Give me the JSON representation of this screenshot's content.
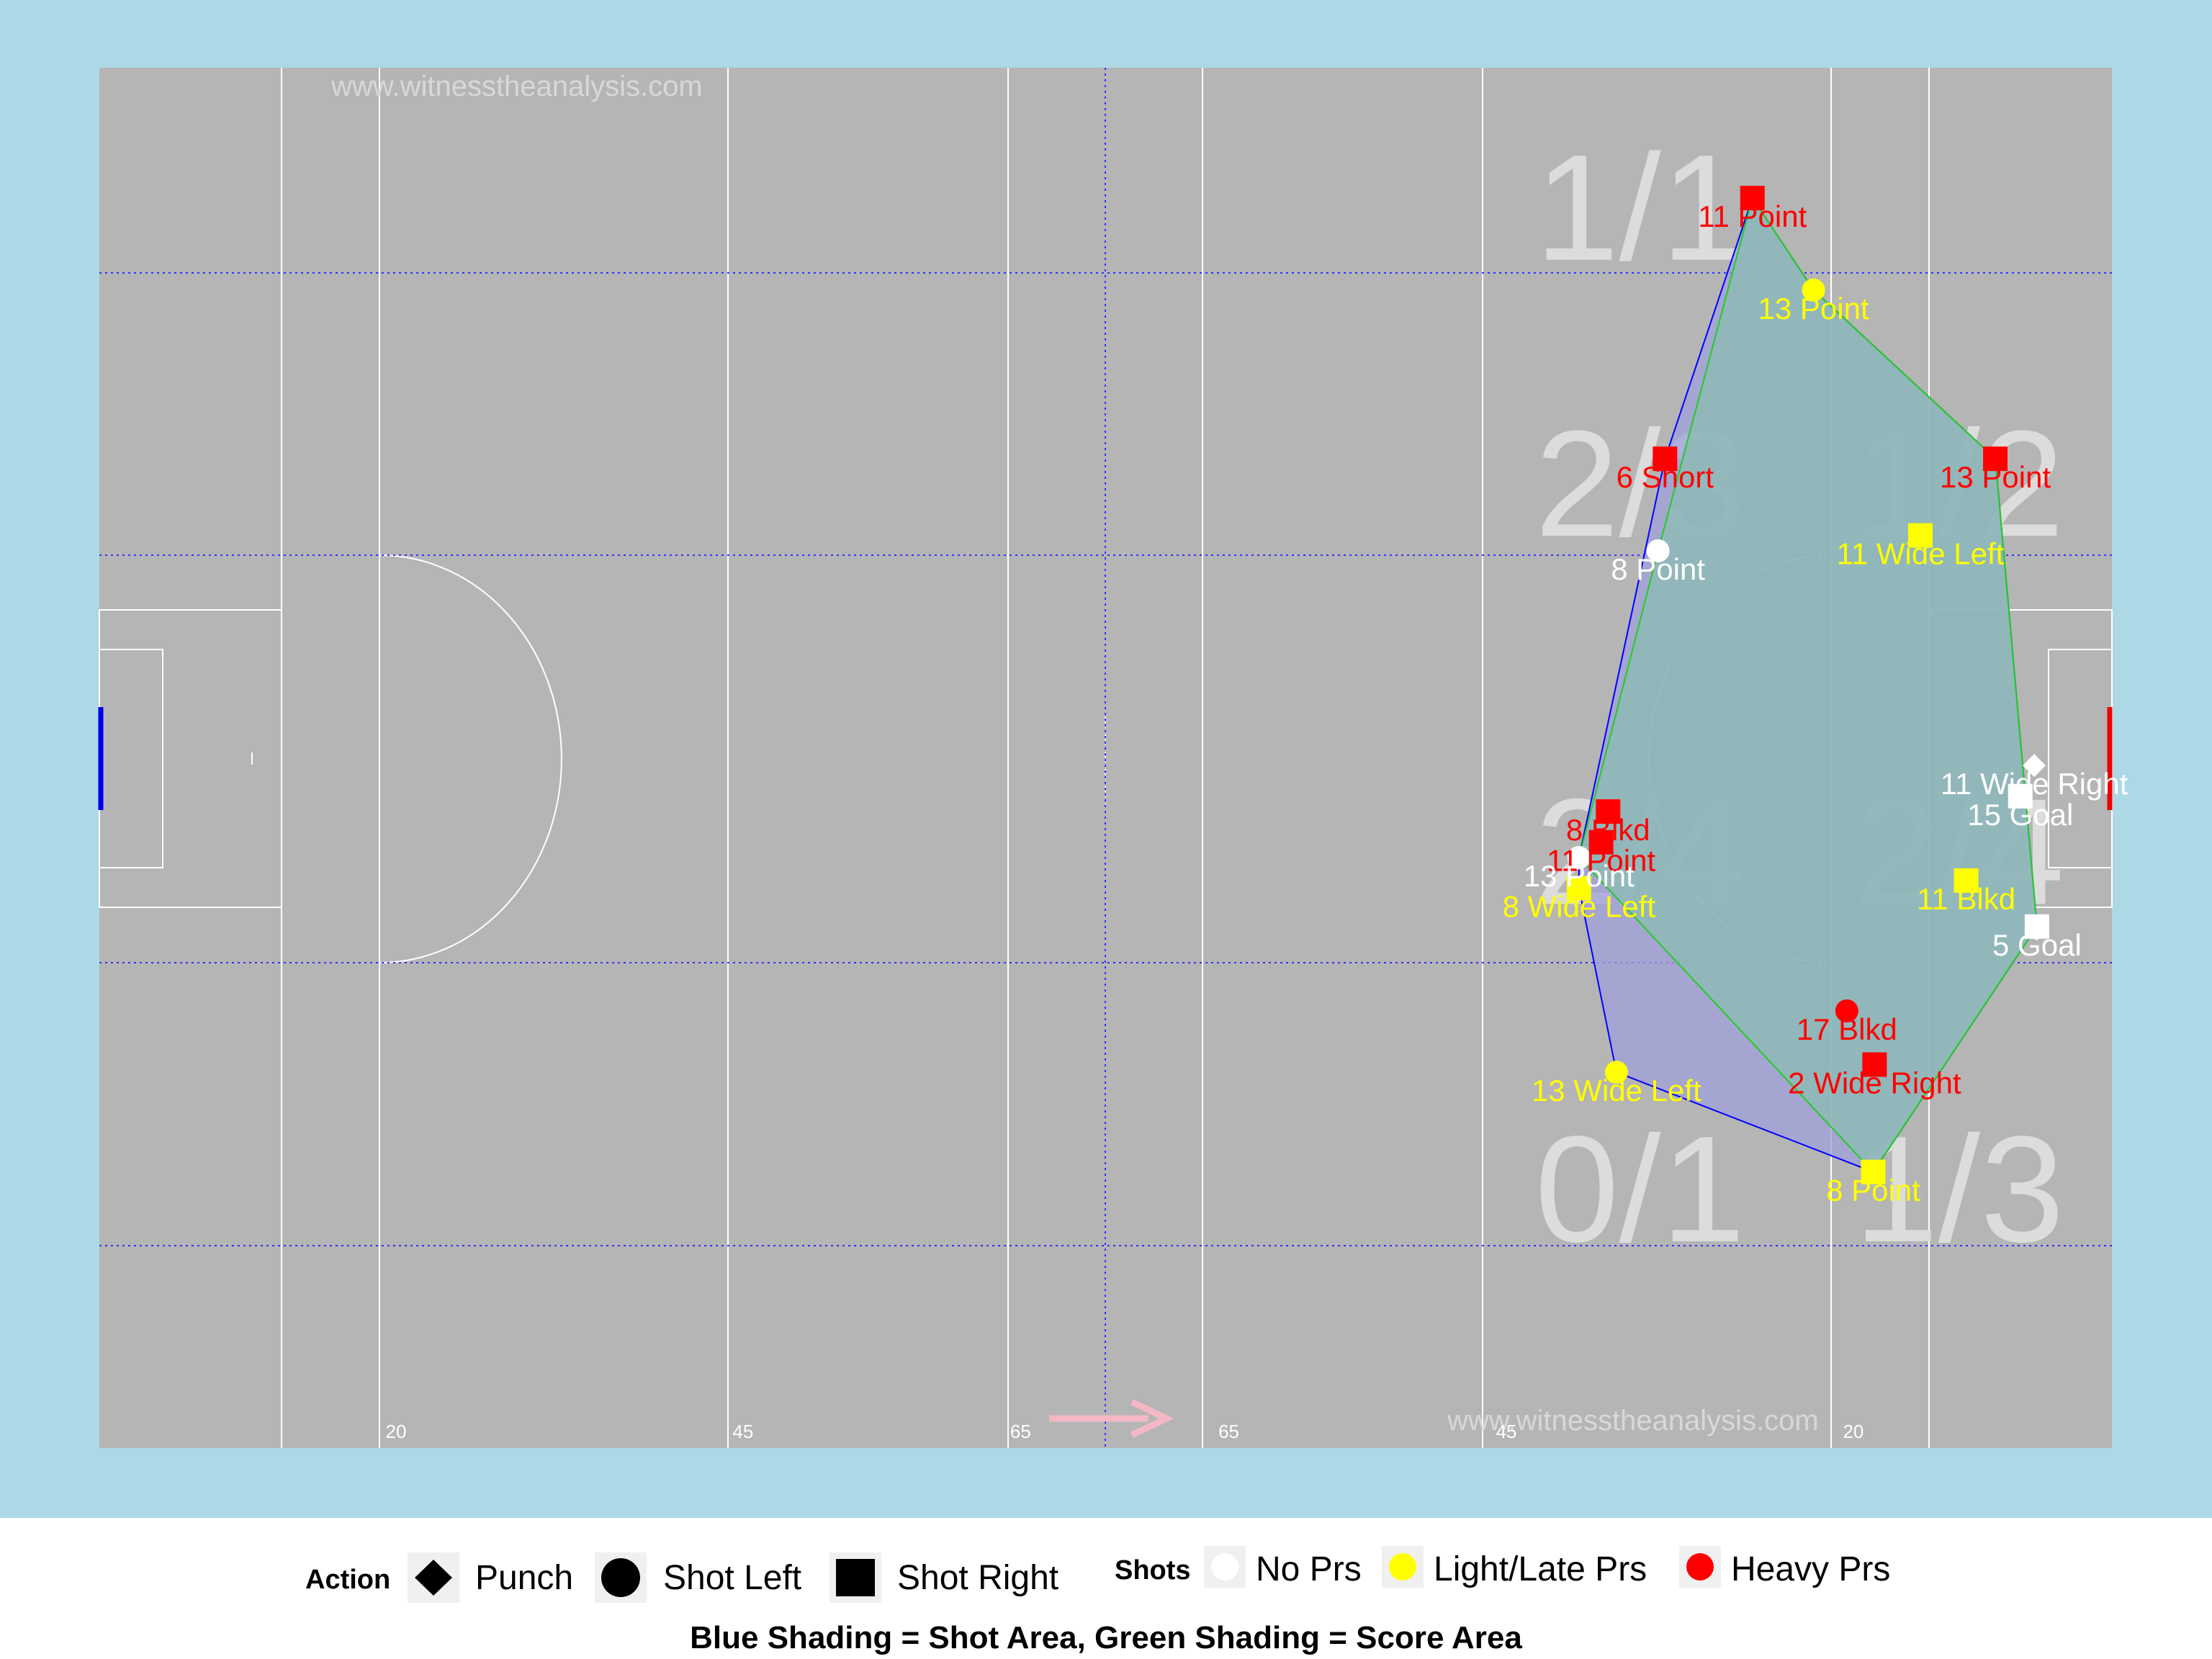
{
  "watermarks": [
    "www.witnesstheanalysis.com",
    "www.witnesstheanalysis.com"
  ],
  "direction_arrow": "right",
  "distance_labels": [
    "20",
    "45",
    "65",
    "65",
    "45",
    "20"
  ],
  "zone_labels": [
    "1/1",
    "2/3",
    "1/2",
    "2/4",
    "2/4",
    "0/1",
    "1/3"
  ],
  "legend": {
    "action_title": "Action",
    "action_items": [
      {
        "shape": "diamond",
        "label": "Punch"
      },
      {
        "shape": "circle",
        "label": "Shot Left"
      },
      {
        "shape": "square",
        "label": "Shot Right"
      }
    ],
    "shots_title": "Shots",
    "shots_items": [
      {
        "color": "#ffffff",
        "label": "No Prs"
      },
      {
        "color": "#ffff00",
        "label": "Light/Late Prs"
      },
      {
        "color": "#ff0000",
        "label": "Heavy Prs"
      }
    ],
    "caption": "Blue Shading = Shot Area, Green Shading = Score Area"
  },
  "colors": {
    "background": "#add8e6",
    "pitch": "#b5b5b5",
    "no_pressure": "#ffffff",
    "light_pressure": "#ffff00",
    "heavy_pressure": "#ff0000",
    "shot_area": "#a0a0dc",
    "score_area": "#8cbcb4",
    "shot_outline": "#0000ff",
    "score_outline": "#22cc22"
  },
  "chart_data": {
    "type": "scatter",
    "title": "",
    "xlabel": "",
    "ylabel": "",
    "xlim": [
      0,
      145
    ],
    "ylim": [
      0,
      90
    ],
    "x_markers": [
      {
        "label": "20",
        "x": 20
      },
      {
        "label": "45",
        "x": 45
      },
      {
        "label": "65",
        "x": 65
      },
      {
        "label": "65",
        "x": 80
      },
      {
        "label": "45",
        "x": 100
      },
      {
        "label": "20",
        "x": 125
      }
    ],
    "zones": [
      {
        "label": "1/1",
        "x": 111,
        "y": 81
      },
      {
        "label": "2/3",
        "x": 111,
        "y": 63
      },
      {
        "label": "1/2",
        "x": 134,
        "y": 63
      },
      {
        "label": "2/4",
        "x": 111,
        "y": 39
      },
      {
        "label": "2/4",
        "x": 134,
        "y": 39
      },
      {
        "label": "0/1",
        "x": 111,
        "y": 17
      },
      {
        "label": "1/3",
        "x": 134,
        "y": 17
      }
    ],
    "shots": [
      {
        "label": "11 Point",
        "x": 119.1,
        "y": 81.5,
        "shape": "square",
        "pressure": "heavy"
      },
      {
        "label": "13 Point",
        "x": 123.5,
        "y": 75.5,
        "shape": "circle",
        "pressure": "light"
      },
      {
        "label": "6 Short",
        "x": 112.8,
        "y": 64.5,
        "shape": "square",
        "pressure": "heavy"
      },
      {
        "label": "13 Point",
        "x": 136.6,
        "y": 64.5,
        "shape": "square",
        "pressure": "heavy"
      },
      {
        "label": "8 Point",
        "x": 112.3,
        "y": 58.5,
        "shape": "circle",
        "pressure": "none"
      },
      {
        "label": "11 Wide Left",
        "x": 131.2,
        "y": 59.5,
        "shape": "square",
        "pressure": "light"
      },
      {
        "label": "11 Wide Right",
        "x": 139.4,
        "y": 44.5,
        "shape": "diamond",
        "pressure": "none"
      },
      {
        "label": "15 Goal",
        "x": 138.4,
        "y": 42.5,
        "shape": "square",
        "pressure": "none"
      },
      {
        "label": "8 Blkd",
        "x": 108.7,
        "y": 41.5,
        "shape": "square",
        "pressure": "heavy"
      },
      {
        "label": "11 Point",
        "x": 108.2,
        "y": 39.5,
        "shape": "square",
        "pressure": "heavy"
      },
      {
        "label": "13 Point",
        "x": 106.6,
        "y": 38.5,
        "shape": "circle",
        "pressure": "none"
      },
      {
        "label": "8 Wide Left",
        "x": 106.6,
        "y": 36.5,
        "shape": "square",
        "pressure": "light"
      },
      {
        "label": "11 Blkd",
        "x": 134.5,
        "y": 37.0,
        "shape": "square",
        "pressure": "light"
      },
      {
        "label": "5 Goal",
        "x": 139.6,
        "y": 34.0,
        "shape": "square",
        "pressure": "none"
      },
      {
        "label": "17 Blkd",
        "x": 125.9,
        "y": 28.5,
        "shape": "circle",
        "pressure": "heavy"
      },
      {
        "label": "2 Wide Right",
        "x": 127.9,
        "y": 25.0,
        "shape": "square",
        "pressure": "heavy"
      },
      {
        "label": "13 Wide Left",
        "x": 109.3,
        "y": 24.5,
        "shape": "circle",
        "pressure": "light"
      },
      {
        "label": "8 Point",
        "x": 127.8,
        "y": 18.0,
        "shape": "square",
        "pressure": "light"
      }
    ],
    "shot_area_hull": [
      [
        119.1,
        81.5
      ],
      [
        123.5,
        75.5
      ],
      [
        136.6,
        64.5
      ],
      [
        139.6,
        34.0
      ],
      [
        127.8,
        18.0
      ],
      [
        109.3,
        24.5
      ],
      [
        106.6,
        36.5
      ],
      [
        106.6,
        38.5
      ],
      [
        112.8,
        64.5
      ]
    ],
    "score_area_hull": [
      [
        119.1,
        81.5
      ],
      [
        123.5,
        75.5
      ],
      [
        136.6,
        64.5
      ],
      [
        139.6,
        34.0
      ],
      [
        127.8,
        18.0
      ],
      [
        106.6,
        38.5
      ],
      [
        112.3,
        58.5
      ]
    ]
  }
}
